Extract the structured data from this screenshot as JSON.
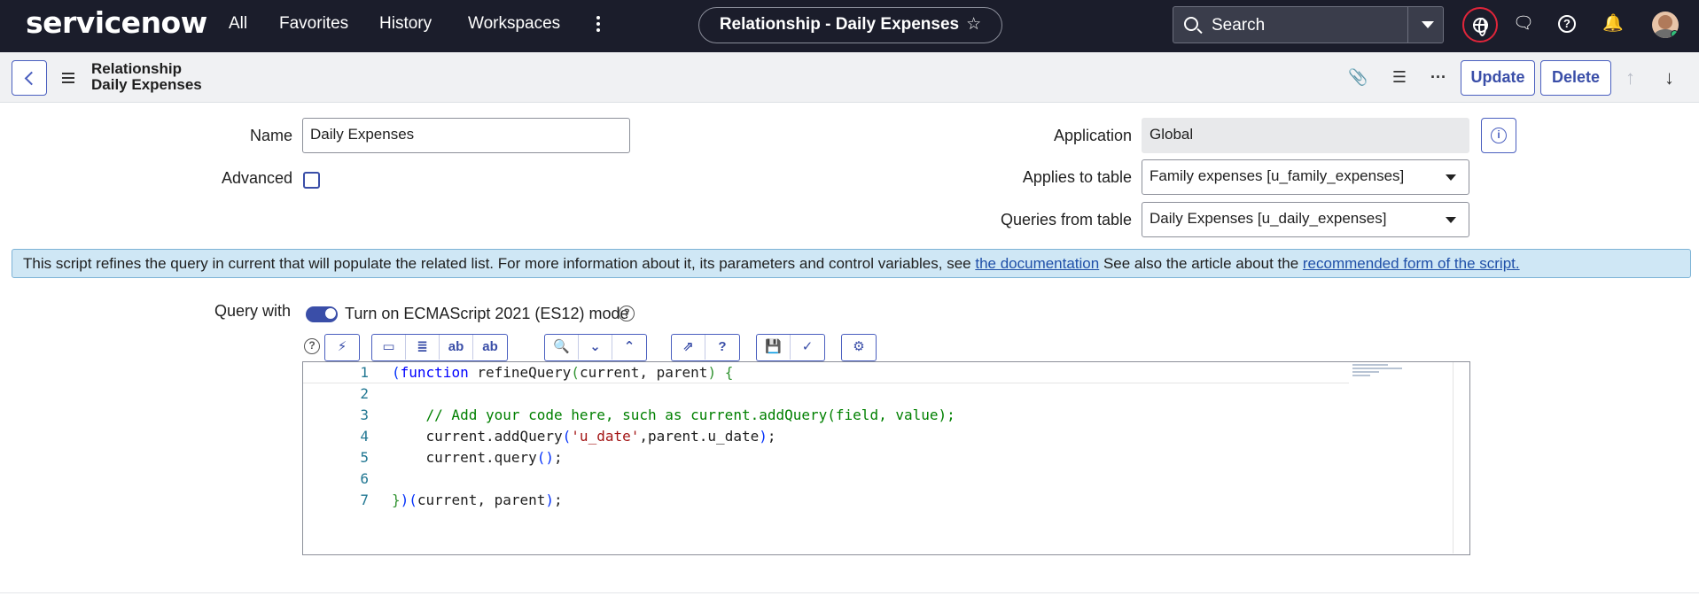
{
  "topnav": {
    "logo": "servicenow",
    "items": [
      "All",
      "Favorites",
      "History",
      "Workspaces"
    ],
    "title": "Relationship - Daily Expenses",
    "search_label": "Search"
  },
  "header": {
    "record_type": "Relationship",
    "record_name": "Daily Expenses",
    "update_label": "Update",
    "delete_label": "Delete"
  },
  "form": {
    "name_label": "Name",
    "name_value": "Daily Expenses",
    "advanced_label": "Advanced",
    "application_label": "Application",
    "application_value": "Global",
    "applies_label": "Applies to table",
    "applies_value": "Family expenses [u_family_expenses]",
    "queries_label": "Queries from table",
    "queries_value": "Daily Expenses [u_daily_expenses]"
  },
  "notice": {
    "text1": "This script refines the query in current that will populate the related list. For more information about it, its parameters and control variables, see ",
    "link1": "the documentation",
    "text2": " See also the article about the ",
    "link2": "recommended form of the script."
  },
  "script": {
    "label": "Query with",
    "toggle_label": "Turn on ECMAScript 2021 (ES12) mode",
    "line_numbers": [
      "1",
      "2",
      "3",
      "4",
      "5",
      "6",
      "7"
    ]
  },
  "colors": {
    "nav_bg": "#1b1d2b",
    "accent": "#3a4ea8",
    "notice_bg": "#cfe7f5"
  }
}
